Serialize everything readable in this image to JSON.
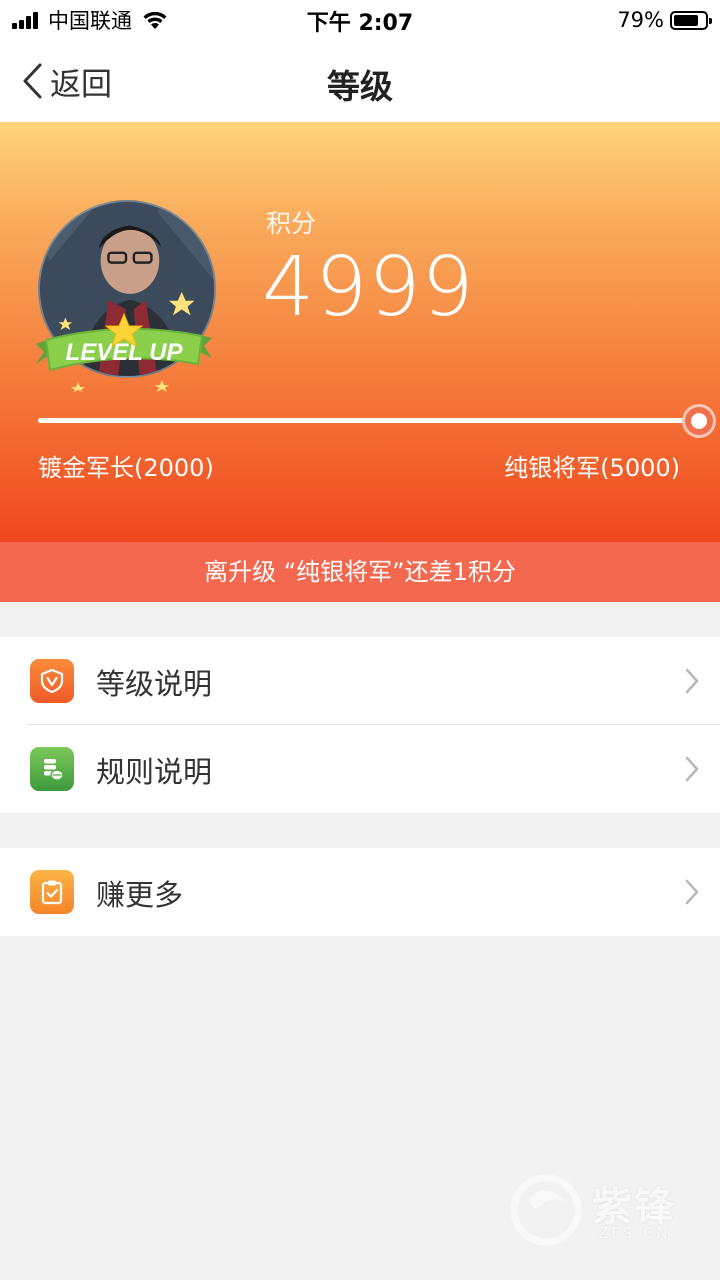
{
  "status_bar": {
    "carrier": "中国联通",
    "time": "下午 2:07",
    "battery_percent": "79%",
    "battery_level": 0.79
  },
  "nav": {
    "back_label": "返回",
    "title": "等级"
  },
  "hero": {
    "badge_text": "LEVEL UP",
    "score_label": "积分",
    "score_value": "4999",
    "progress": 0.9998,
    "current_level": "镀金军长(2000)",
    "next_level": "纯银将军(5000)",
    "tip": "离升级 “纯银将军”还差1积分"
  },
  "menu": {
    "group1": [
      {
        "label": "等级说明",
        "icon": "shield-icon",
        "color": "#f26a2e"
      },
      {
        "label": "规则说明",
        "icon": "coins-icon",
        "color": "#56b04a"
      }
    ],
    "group2": [
      {
        "label": "赚更多",
        "icon": "clipboard-check-icon",
        "color": "#f79a35"
      }
    ]
  },
  "watermark": {
    "brand": "紫锋",
    "sub": "ZFS.CN"
  }
}
